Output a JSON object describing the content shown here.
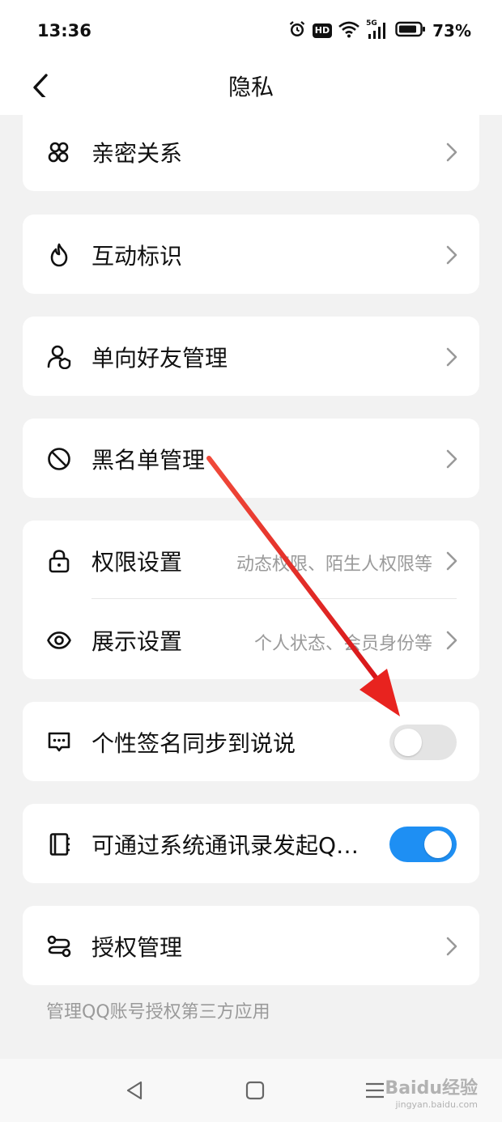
{
  "status_bar": {
    "time": "13:36",
    "network_badge": "HD",
    "signal_label": "5G",
    "battery_percent": "73%",
    "icons": [
      "alarm-icon",
      "hd-icon",
      "wifi-icon",
      "signal-icon",
      "battery-icon"
    ]
  },
  "header": {
    "title": "隐私",
    "back_icon": "back-arrow-icon"
  },
  "rows": {
    "intimate": {
      "label": "亲密关系",
      "icon": "intimate-relation-icon"
    },
    "interaction": {
      "label": "互动标识",
      "icon": "flame-icon"
    },
    "oneway": {
      "label": "单向好友管理",
      "icon": "user-shield-icon"
    },
    "blacklist": {
      "label": "黑名单管理",
      "icon": "block-icon"
    },
    "permission": {
      "label": "权限设置",
      "sub": "动态权限、陌生人权限等",
      "icon": "lock-icon"
    },
    "display": {
      "label": "展示设置",
      "sub": "个人状态、会员身份等",
      "icon": "eye-icon"
    },
    "signature_sync": {
      "label": "个性签名同步到说说",
      "icon": "message-icon",
      "enabled": false
    },
    "contacts": {
      "label": "可通过系统通讯录发起Q…",
      "icon": "contacts-book-icon",
      "enabled": true
    },
    "authorization": {
      "label": "授权管理",
      "icon": "auth-link-icon"
    }
  },
  "footnote": "管理QQ账号授权第三方应用",
  "nav_bar": {
    "buttons": [
      "back-triangle-icon",
      "home-square-icon",
      "menu-lines-icon"
    ]
  },
  "watermark": {
    "brand": "Baidu经验",
    "url": "jingyan.baidu.com"
  },
  "colors": {
    "accent": "#1e8ff3",
    "toggle_off": "#e4e4e4",
    "annotation_arrow": "#e8231f",
    "background": "#f2f2f2"
  }
}
